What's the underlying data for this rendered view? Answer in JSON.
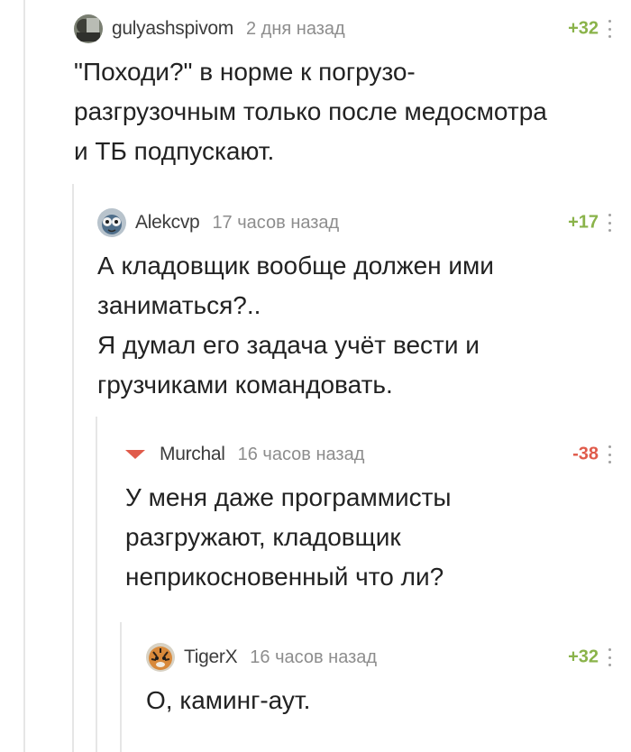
{
  "comments": [
    {
      "username": "gulyashspivom",
      "time": "2 дня назад",
      "rating": "+32",
      "text": "\"Походи?\" в норме к погрузо-\nразгрузочным только после медосмотра\nи ТБ подпускают."
    },
    {
      "username": "Alekcvp",
      "time": "17 часов назад",
      "rating": "+17",
      "text": "А кладовщик вообще должен ими\nзаниматься?..\nЯ думал его задача учёт вести и\nгрузчиками командовать."
    },
    {
      "username": "Murchal",
      "time": "16 часов назад",
      "rating": "-38",
      "text": "У меня даже программисты\nразгружают, кладовщик\nнеприкосновенный что ли?"
    },
    {
      "username": "TigerX",
      "time": "16 часов назад",
      "rating": "+32",
      "text": "О, каминг-аут."
    }
  ],
  "colors": {
    "positive_rating": "#8ab34a",
    "negative_rating": "#e05b4b",
    "timestamp": "#8d8d8d",
    "thread_line": "#e6e6e6"
  },
  "icons": {
    "more": "more-vertical-icon",
    "downvoted": "downvote-arrow-icon"
  }
}
